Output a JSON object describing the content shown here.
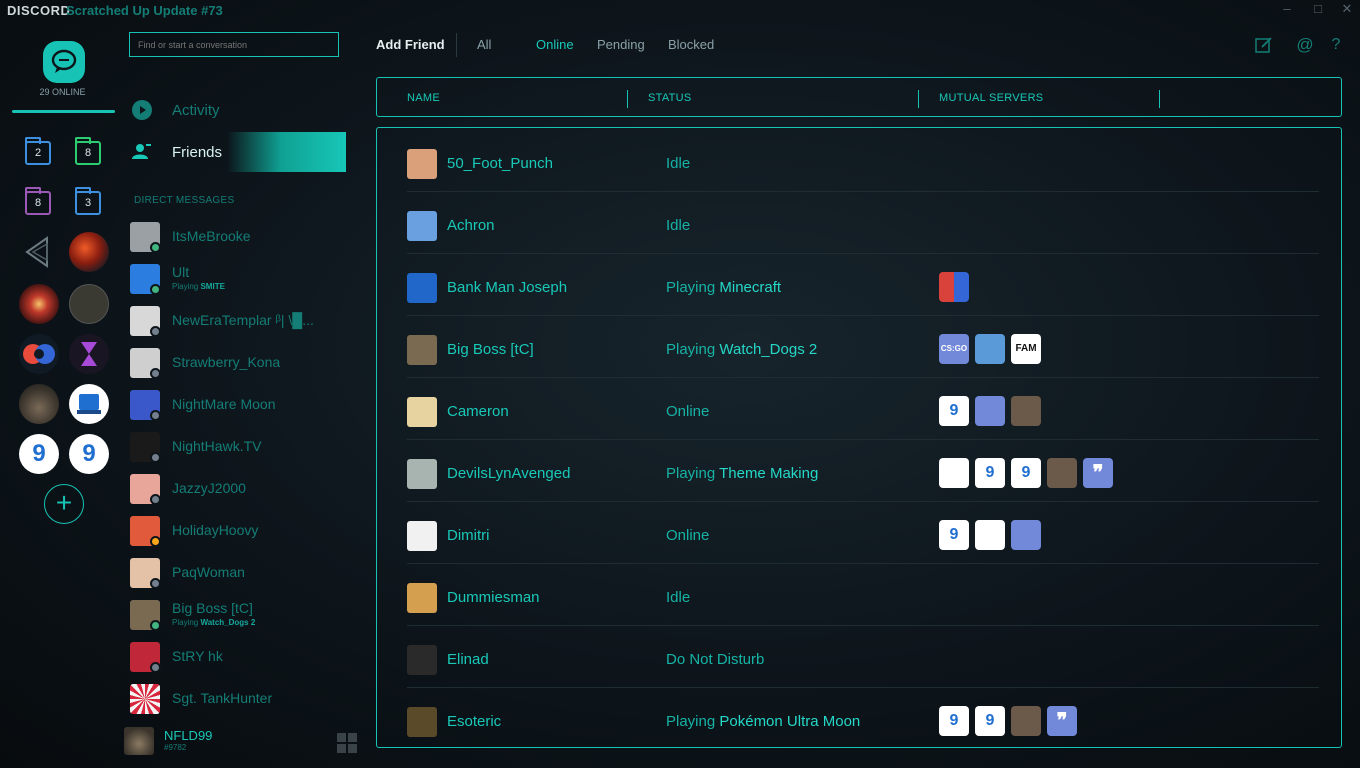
{
  "window": {
    "brand": "DISCORD",
    "title": "Scratched Up Update #73",
    "controls": [
      "–",
      "□",
      "✕"
    ]
  },
  "servers": {
    "online_count": "29 ONLINE",
    "folders": [
      {
        "count": "2",
        "color": "#3d8fe0"
      },
      {
        "count": "8",
        "color": "#2ecc71"
      },
      {
        "count": "8",
        "color": "#9b59b6"
      },
      {
        "count": "3",
        "color": "#3d8fe0"
      }
    ],
    "add_label": "+"
  },
  "search": {
    "placeholder": "Find or start a conversation"
  },
  "nav": {
    "activity": "Activity",
    "friends": "Friends"
  },
  "dm_header": "DIRECT MESSAGES",
  "dms": [
    {
      "name": "ItsMeBrooke",
      "status_color": "#43b581",
      "avatar": "#9aa0a4"
    },
    {
      "name": "Ult",
      "sub_prefix": "Playing ",
      "sub_game": "SMITE",
      "status_color": "#43b581",
      "avatar": "#2b7de0"
    },
    {
      "name": "NewEraTemplar ᵝ| \\█...",
      "status_color": "#747f8d",
      "avatar": "#d8d8d8"
    },
    {
      "name": "Strawberry_Kona",
      "status_color": "#747f8d",
      "avatar": "#cfcfcf"
    },
    {
      "name": "NightMare Moon",
      "status_color": "#747f8d",
      "avatar": "#3a58c9"
    },
    {
      "name": "NightHawk.TV",
      "status_color": "#747f8d",
      "avatar": "#1a1a1a"
    },
    {
      "name": "JazzyJ2000",
      "status_color": "#747f8d",
      "avatar": "#e8a69a"
    },
    {
      "name": "HolidayHoovy",
      "status_color": "#faa61a",
      "avatar": "#e25a3c"
    },
    {
      "name": "PaqWoman",
      "status_color": "#747f8d",
      "avatar": "#e3c2a8"
    },
    {
      "name": "Big Boss [tC]",
      "sub_prefix": "Playing ",
      "sub_game": "Watch_Dogs 2",
      "status_color": "#43b581",
      "avatar": "#7a6a52"
    },
    {
      "name": "StRY hk",
      "status_color": "#747f8d",
      "avatar": "#c0283a"
    },
    {
      "name": "Sgt. TankHunter",
      "status_color": "#747f8d",
      "avatar": "#d7263d"
    }
  ],
  "user": {
    "name": "NFLD99",
    "tag": "#9782"
  },
  "tabs": {
    "add_friend": "Add Friend",
    "all": "All",
    "online": "Online",
    "pending": "Pending",
    "blocked": "Blocked"
  },
  "top_icons": [
    "new-dm-icon",
    "mention-icon",
    "help-icon"
  ],
  "table": {
    "headers": {
      "name": "NAME",
      "status": "STATUS",
      "mutual": "MUTUAL SERVERS"
    },
    "rows": [
      {
        "name": "50_Foot_Punch",
        "status": "Idle",
        "avatar": "#d9a07a",
        "mutuals": []
      },
      {
        "name": "Achron",
        "status": "Idle",
        "avatar": "#6aa0e0",
        "mutuals": []
      },
      {
        "name": "Bank Man Joseph",
        "status": "Playing ",
        "game": "Minecraft",
        "avatar": "#2167c9",
        "mutuals": [
          {
            "label": "",
            "color": "#d8423b"
          }
        ]
      },
      {
        "name": "Big Boss [tC]",
        "status": "Playing ",
        "game": "Watch_Dogs 2",
        "avatar": "#7a6a52",
        "mutuals": [
          {
            "label": "CS:GO",
            "color": "#7289da"
          },
          {
            "label": "",
            "color": "#5a9ad8"
          },
          {
            "label": "FAM",
            "color": "#ffffff"
          }
        ]
      },
      {
        "name": "Cameron",
        "status": "Online",
        "avatar": "#e6d3a0",
        "mutuals": [
          {
            "label": "9",
            "color": "#ffffff"
          },
          {
            "label": "",
            "color": "#7289da"
          },
          {
            "label": "",
            "color": "#6b5a4a"
          }
        ]
      },
      {
        "name": "DevilsLynAvenged",
        "status": "Playing ",
        "game": "Theme Making",
        "avatar": "#a8b4b0",
        "mutuals": [
          {
            "label": "",
            "color": "#ffffff"
          },
          {
            "label": "9",
            "color": "#ffffff"
          },
          {
            "label": "9",
            "color": "#ffffff"
          },
          {
            "label": "",
            "color": "#6b5a4a"
          },
          {
            "label": "❞",
            "color": "#7289da"
          }
        ]
      },
      {
        "name": "Dimitri",
        "status": "Online",
        "avatar": "#f1f1f1",
        "mutuals": [
          {
            "label": "9",
            "color": "#ffffff"
          },
          {
            "label": "",
            "color": "#ffffff"
          },
          {
            "label": "",
            "color": "#7289da"
          }
        ]
      },
      {
        "name": "Dummiesman",
        "status": "Idle",
        "avatar": "#d4a050",
        "mutuals": []
      },
      {
        "name": "Elinad",
        "status": "Do Not Disturb",
        "avatar": "#2a2a2a",
        "mutuals": []
      },
      {
        "name": "Esoteric",
        "status": "Playing ",
        "game": "Pokémon Ultra Moon",
        "avatar": "#5a4a2a",
        "mutuals": [
          {
            "label": "9",
            "color": "#ffffff"
          },
          {
            "label": "9",
            "color": "#ffffff"
          },
          {
            "label": "",
            "color": "#6b5a4a"
          },
          {
            "label": "❞",
            "color": "#7289da"
          }
        ]
      }
    ]
  }
}
